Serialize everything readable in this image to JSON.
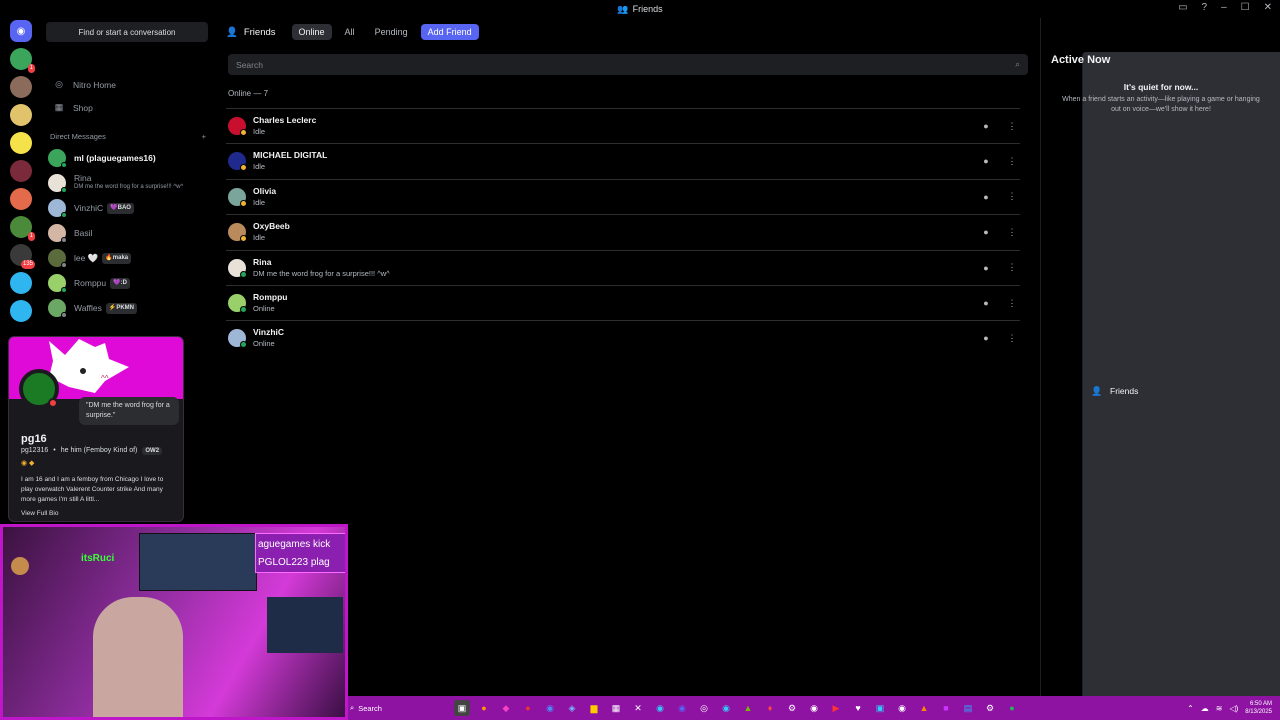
{
  "window": {
    "title": "Friends"
  },
  "sidebar": {
    "find_label": "Find or start a conversation",
    "nav": [
      {
        "label": "Friends",
        "icon": "friends-icon"
      },
      {
        "label": "Nitro Home",
        "icon": "nitro-icon"
      },
      {
        "label": "Shop",
        "icon": "shop-icon"
      }
    ],
    "dm_header": "Direct Messages",
    "dm_add": "+",
    "dms": [
      {
        "name": "ml (plaguegames16)",
        "sub": "",
        "tag": "",
        "color": "#3ba55c",
        "status": "#23a55a"
      },
      {
        "name": "Rina",
        "sub": "DM me the word frog for a surprise!!! ^w^",
        "tag": "",
        "color": "#e8e1d8",
        "status": "#23a55a"
      },
      {
        "name": "VinzhiC",
        "sub": "",
        "tag": "💜BAO",
        "color": "#9fb7d6",
        "status": "#23a55a"
      },
      {
        "name": "Basil",
        "sub": "",
        "tag": "",
        "color": "#d3b6a4",
        "status": "#80848e"
      },
      {
        "name": "lee 🤍",
        "sub": "",
        "tag": "🔥maka",
        "color": "#5c6b3c",
        "status": "#80848e"
      },
      {
        "name": "Romppu",
        "sub": "",
        "tag": "💜:D",
        "color": "#9ad06a",
        "status": "#23a55a"
      },
      {
        "name": "Waffles",
        "sub": "",
        "tag": "⚡PKMN",
        "color": "#6ca865",
        "status": "#80848e"
      }
    ]
  },
  "profile": {
    "status_bubble": "\"DM me the word frog for a surprise.\"",
    "name": "pg16",
    "username": "pg12316",
    "pronouns": "he him (Femboy Kind of)",
    "badge_tag": "OW2",
    "bio": "I am 16 and I am a femboy from Chicago I love to play overwatch Valerent Counter strike And many more games I'm still A littl...",
    "view_bio": "View Full Bio"
  },
  "webcam": {
    "label_name": "itsRuci",
    "sign_line1": "aguegames kick",
    "sign_line2": "PGLOL223 plag"
  },
  "main": {
    "header": "Friends",
    "tabs": [
      {
        "label": "Online",
        "selected": true
      },
      {
        "label": "All",
        "selected": false
      },
      {
        "label": "Pending",
        "selected": false
      }
    ],
    "add_friend": "Add Friend",
    "search_placeholder": "Search",
    "online_count": "Online — 7",
    "friends": [
      {
        "name": "Charles Leclerc",
        "status_text": "Idle",
        "color": "#c8102e",
        "status": "#f0b232"
      },
      {
        "name": "MICHAEL DIGITAL",
        "status_text": "Idle",
        "color": "#1f2a8c",
        "status": "#f0b232"
      },
      {
        "name": "Olivia",
        "status_text": "Idle",
        "color": "#7aa59a",
        "status": "#f0b232"
      },
      {
        "name": "OxyBeeb",
        "status_text": "Idle",
        "color": "#b98a5c",
        "status": "#f0b232"
      },
      {
        "name": "Rina",
        "status_text": "DM me the word frog for a surprise!!! ^w^",
        "color": "#e8e1d8",
        "status": "#23a55a"
      },
      {
        "name": "Romppu",
        "status_text": "Online",
        "color": "#9ad06a",
        "status": "#23a55a"
      },
      {
        "name": "VinzhiC",
        "status_text": "Online",
        "color": "#9fb7d6",
        "status": "#23a55a"
      }
    ]
  },
  "active_now": {
    "title": "Active Now",
    "quiet": "It's quiet for now...",
    "desc": "When a friend starts an activity—like playing a game or hanging out on voice—we'll show it here!"
  },
  "taskbar": {
    "search": "Search",
    "time": "6:50 AM",
    "date": "8/13/2025"
  },
  "colors": {
    "accent": "#5865f2",
    "taskbar": "#8e13a3",
    "idle": "#f0b232",
    "online": "#23a55a"
  }
}
